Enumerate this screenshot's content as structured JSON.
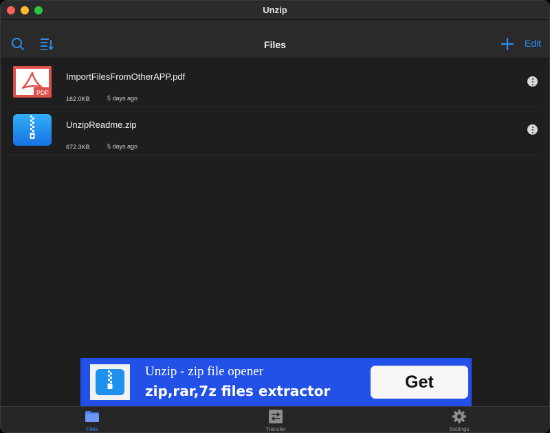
{
  "window": {
    "title": "Unzip"
  },
  "navbar": {
    "title": "Files",
    "edit_label": "Edit"
  },
  "files": [
    {
      "name": "ImportFilesFromOtherAPP.pdf",
      "size": "162.0KB",
      "modified": "5 days ago",
      "type": "pdf",
      "badge": "PDF"
    },
    {
      "name": "UnzipReadme.zip",
      "size": "672.3KB",
      "modified": "5 days ago",
      "type": "zip"
    }
  ],
  "ad": {
    "title": "Unzip - zip file opener",
    "subtitle": "zip,rar,7z files extractor",
    "cta": "Get"
  },
  "tabs": [
    {
      "label": "Files",
      "icon": "folder-icon",
      "active": true
    },
    {
      "label": "Transfer",
      "icon": "transfer-icon",
      "active": false
    },
    {
      "label": "Settings",
      "icon": "gear-icon",
      "active": false
    }
  ],
  "colors": {
    "accent": "#2f8cf0",
    "pdf": "#e0504b",
    "zip": "#1e90ee",
    "ad_background": "#2350e6"
  }
}
